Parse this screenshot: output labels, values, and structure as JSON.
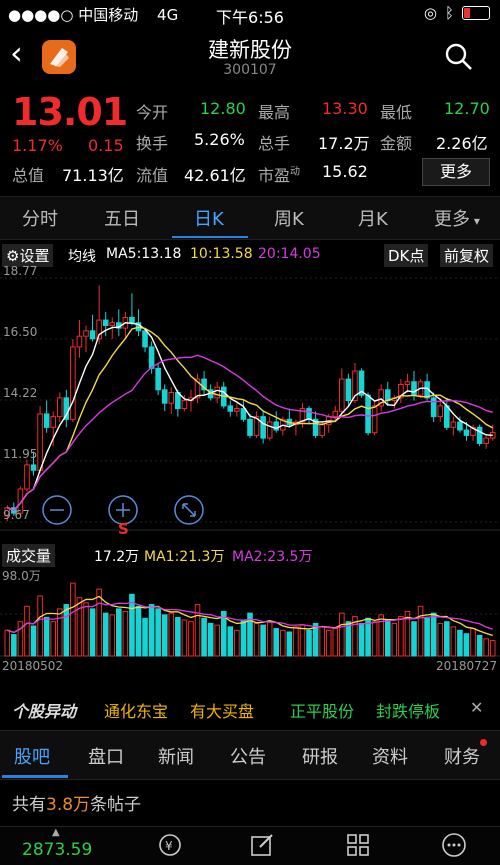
{
  "status": {
    "carrier": "中国移动",
    "network": "4G",
    "time": "下午6:56"
  },
  "header": {
    "title": "建新股份",
    "code": "300107"
  },
  "quote": {
    "price": "13.01",
    "change_pct": "1.17%",
    "change": "0.15",
    "rows": [
      [
        {
          "label": "今开",
          "value": "12.80",
          "color": "green"
        },
        {
          "label": "最高",
          "value": "13.30",
          "color": "red"
        },
        {
          "label": "最低",
          "value": "12.70",
          "color": "green"
        }
      ],
      [
        {
          "label": "换手",
          "value": "5.26%",
          "color": "white"
        },
        {
          "label": "总手",
          "value": "17.2万",
          "color": "white"
        },
        {
          "label": "金额",
          "value": "2.26亿",
          "color": "white"
        }
      ],
      [
        {
          "label": "总值",
          "value": "71.13亿",
          "color": "white"
        },
        {
          "label": "流值",
          "value": "42.61亿",
          "color": "white"
        },
        {
          "label": "市盈",
          "sup": "动",
          "value": "15.62",
          "color": "white"
        }
      ]
    ],
    "more_label": "更多"
  },
  "period_tabs": [
    "分时",
    "五日",
    "日K",
    "周K",
    "月K",
    "更多"
  ],
  "active_period": "日K",
  "ma_row": {
    "settings": "设置",
    "label": "均线",
    "ma5": "MA5:13.18",
    "ma10": "10:13.58",
    "ma20": "20:14.05",
    "dk_button": "DK点",
    "restore_button": "前复权"
  },
  "chart_data": {
    "type": "candlestick",
    "y_ticks": [
      "18.77",
      "16.50",
      "14.22",
      "11.95",
      "9.67"
    ],
    "ylim": [
      9.67,
      18.77
    ],
    "ohlc": [
      [
        9.9,
        10.3,
        9.7,
        10.2
      ],
      [
        10.2,
        10.4,
        9.9,
        10.0
      ],
      [
        10.0,
        11.0,
        9.9,
        10.9
      ],
      [
        10.9,
        12.0,
        10.8,
        11.8
      ],
      [
        11.8,
        12.3,
        11.4,
        11.6
      ],
      [
        11.6,
        14.0,
        11.5,
        13.7
      ],
      [
        13.7,
        14.2,
        13.0,
        13.2
      ],
      [
        13.2,
        13.8,
        12.5,
        13.6
      ],
      [
        13.6,
        14.5,
        13.4,
        14.3
      ],
      [
        14.3,
        14.6,
        13.2,
        13.5
      ],
      [
        13.5,
        16.5,
        13.4,
        16.2
      ],
      [
        16.2,
        17.2,
        15.8,
        16.6
      ],
      [
        16.6,
        17.0,
        16.0,
        16.8
      ],
      [
        16.8,
        17.4,
        16.4,
        16.5
      ],
      [
        16.5,
        18.5,
        16.3,
        17.2
      ],
      [
        17.2,
        17.5,
        16.6,
        17.0
      ],
      [
        17.0,
        17.3,
        16.5,
        17.1
      ],
      [
        17.1,
        17.6,
        16.6,
        16.9
      ],
      [
        16.9,
        17.5,
        16.5,
        17.3
      ],
      [
        17.3,
        18.2,
        17.0,
        17.1
      ],
      [
        17.1,
        17.6,
        16.6,
        16.8
      ],
      [
        16.8,
        16.9,
        16.0,
        16.2
      ],
      [
        16.2,
        16.4,
        15.2,
        15.4
      ],
      [
        15.4,
        15.6,
        14.4,
        14.6
      ],
      [
        14.6,
        14.8,
        13.8,
        14.1
      ],
      [
        14.1,
        14.7,
        13.7,
        14.5
      ],
      [
        14.5,
        14.6,
        13.6,
        13.9
      ],
      [
        13.9,
        14.4,
        13.8,
        14.2
      ],
      [
        14.2,
        14.6,
        13.8,
        14.3
      ],
      [
        14.3,
        15.2,
        14.1,
        15.0
      ],
      [
        15.0,
        15.3,
        14.4,
        14.6
      ],
      [
        14.6,
        14.8,
        14.2,
        14.3
      ],
      [
        14.3,
        14.9,
        14.1,
        14.7
      ],
      [
        14.7,
        14.9,
        13.9,
        14.0
      ],
      [
        14.0,
        14.2,
        13.6,
        13.8
      ],
      [
        13.8,
        14.1,
        13.6,
        13.9
      ],
      [
        13.9,
        14.2,
        13.4,
        13.5
      ],
      [
        13.5,
        13.7,
        12.8,
        12.9
      ],
      [
        12.9,
        13.8,
        12.8,
        13.6
      ],
      [
        13.6,
        13.8,
        12.6,
        12.8
      ],
      [
        12.8,
        13.6,
        12.7,
        13.4
      ],
      [
        13.4,
        13.8,
        13.0,
        13.1
      ],
      [
        13.1,
        13.6,
        12.9,
        13.5
      ],
      [
        13.5,
        13.9,
        13.2,
        13.3
      ],
      [
        13.3,
        13.5,
        12.9,
        13.4
      ],
      [
        13.4,
        14.1,
        13.2,
        13.9
      ],
      [
        13.9,
        14.0,
        13.3,
        13.5
      ],
      [
        13.5,
        13.8,
        12.8,
        12.9
      ],
      [
        12.9,
        13.4,
        12.8,
        13.3
      ],
      [
        13.3,
        13.7,
        13.0,
        13.6
      ],
      [
        13.6,
        14.0,
        13.4,
        13.8
      ],
      [
        13.8,
        15.4,
        13.7,
        15.0
      ],
      [
        15.0,
        15.2,
        14.0,
        14.2
      ],
      [
        14.2,
        15.6,
        14.1,
        15.3
      ],
      [
        15.3,
        15.4,
        14.3,
        14.4
      ],
      [
        14.4,
        14.5,
        12.9,
        13.0
      ],
      [
        13.0,
        14.2,
        12.9,
        14.0
      ],
      [
        14.0,
        14.8,
        13.8,
        14.6
      ],
      [
        14.6,
        14.9,
        14.0,
        14.2
      ],
      [
        14.2,
        14.4,
        13.9,
        14.3
      ],
      [
        14.3,
        15.0,
        14.1,
        14.8
      ],
      [
        14.8,
        15.2,
        14.5,
        14.9
      ],
      [
        14.9,
        15.3,
        14.2,
        14.4
      ],
      [
        14.4,
        15.0,
        14.3,
        14.9
      ],
      [
        14.9,
        15.2,
        14.2,
        14.3
      ],
      [
        14.3,
        14.5,
        13.4,
        13.6
      ],
      [
        13.6,
        14.2,
        13.4,
        14.0
      ],
      [
        14.0,
        14.3,
        13.1,
        13.2
      ],
      [
        13.2,
        13.6,
        12.9,
        13.4
      ],
      [
        13.4,
        13.6,
        13.0,
        13.1
      ],
      [
        13.1,
        13.4,
        12.7,
        12.9
      ],
      [
        12.9,
        13.3,
        12.7,
        13.2
      ],
      [
        13.2,
        13.3,
        12.5,
        12.6
      ],
      [
        12.6,
        12.9,
        12.4,
        12.8
      ],
      [
        12.8,
        13.3,
        12.7,
        13.01
      ]
    ],
    "volume_label": "成交量",
    "volume": "17.2万",
    "ma1": "MA1:21.3万",
    "ma2": "MA2:23.5万",
    "vol_max_label": "98.0万",
    "vol_ylim": [
      0,
      98.0
    ],
    "volumes": [
      30,
      25,
      40,
      58,
      35,
      70,
      45,
      40,
      55,
      60,
      85,
      68,
      62,
      55,
      78,
      50,
      48,
      55,
      52,
      72,
      58,
      44,
      60,
      55,
      48,
      50,
      45,
      42,
      40,
      60,
      44,
      38,
      36,
      52,
      34,
      30,
      42,
      50,
      38,
      36,
      40,
      32,
      30,
      28,
      34,
      36,
      30,
      38,
      34,
      30,
      32,
      50,
      40,
      46,
      38,
      44,
      40,
      48,
      42,
      38,
      46,
      52,
      40,
      58,
      44,
      50,
      38,
      40,
      34,
      30,
      26,
      32,
      24,
      20,
      18
    ],
    "x_start": "20180502",
    "x_end": "20180727"
  },
  "movers": {
    "brand": "个股异动",
    "items": [
      {
        "text": "通化东宝",
        "color": "#f0b400"
      },
      {
        "text": "有大买盘",
        "color": "#f0b400"
      },
      {
        "text": "正平股份",
        "color": "#2ccf4a"
      },
      {
        "text": "封跌停板",
        "color": "#2ccf4a"
      }
    ]
  },
  "bottom_tabs": [
    "股吧",
    "盘口",
    "新闻",
    "公告",
    "研报",
    "资料",
    "财务"
  ],
  "active_bottom_tab": "股吧",
  "posts": {
    "prefix": "共有",
    "count": "3.8万",
    "suffix": "条帖子"
  },
  "footer": {
    "index_value": "2873.59"
  },
  "colors": {
    "up": "#ef2c2c",
    "down": "#17d4d4",
    "ma5": "#ffffff",
    "ma10": "#f5d94a",
    "ma20": "#d63be0",
    "accent": "#2f7fe0"
  }
}
